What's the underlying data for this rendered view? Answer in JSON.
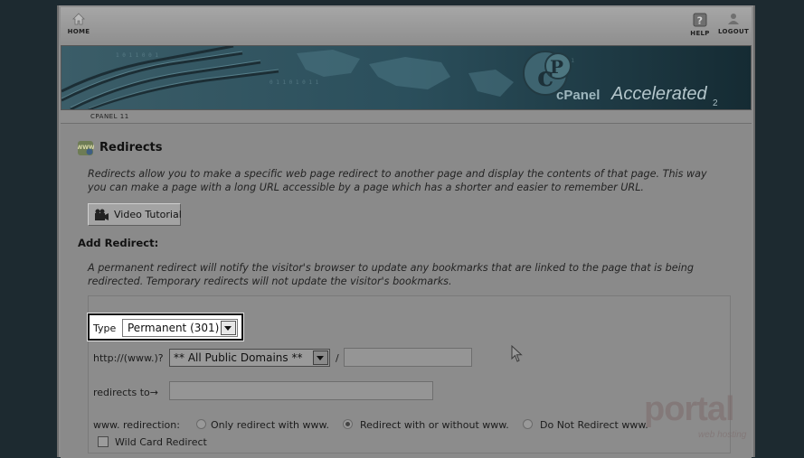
{
  "topnav": {
    "home_label": "HOME",
    "help_label": "HELP",
    "logout_label": "LOGOUT"
  },
  "banner": {
    "logo_text": "cPanel",
    "logo_accelerated": "Accelerated",
    "logo_version": "2"
  },
  "tab_strip": {
    "label": "CPANEL 11"
  },
  "page": {
    "title": "Redirects",
    "description": "Redirects allow you to make a specific web page redirect to another page and display the contents of that page. This way you can make a page with a long URL accessible by a page which has a shorter and easier to remember URL.",
    "video_button": "Video Tutorial",
    "add_heading": "Add Redirect:",
    "add_description": "A permanent redirect will notify the visitor's browser to update any bookmarks that are linked to the page that is being redirected. Temporary redirects will not update the visitor's bookmarks."
  },
  "form": {
    "type_label": "Type",
    "type_value": "Permanent (301)",
    "prefix_label": "http://(www.)?",
    "domain_value": "** All Public Domains **",
    "slash": "/",
    "path_value": "",
    "redirects_to_label": "redirects to→",
    "redirects_to_value": "",
    "www_label": "www. redirection:",
    "www_options": [
      {
        "label": "Only redirect with www.",
        "selected": false
      },
      {
        "label": "Redirect with or without www.",
        "selected": true
      },
      {
        "label": "Do Not Redirect www.",
        "selected": false
      }
    ],
    "wildcard_label": "Wild Card Redirect",
    "wildcard_checked": false
  },
  "watermark": {
    "text": "portal",
    "subtext": "web hosting"
  }
}
